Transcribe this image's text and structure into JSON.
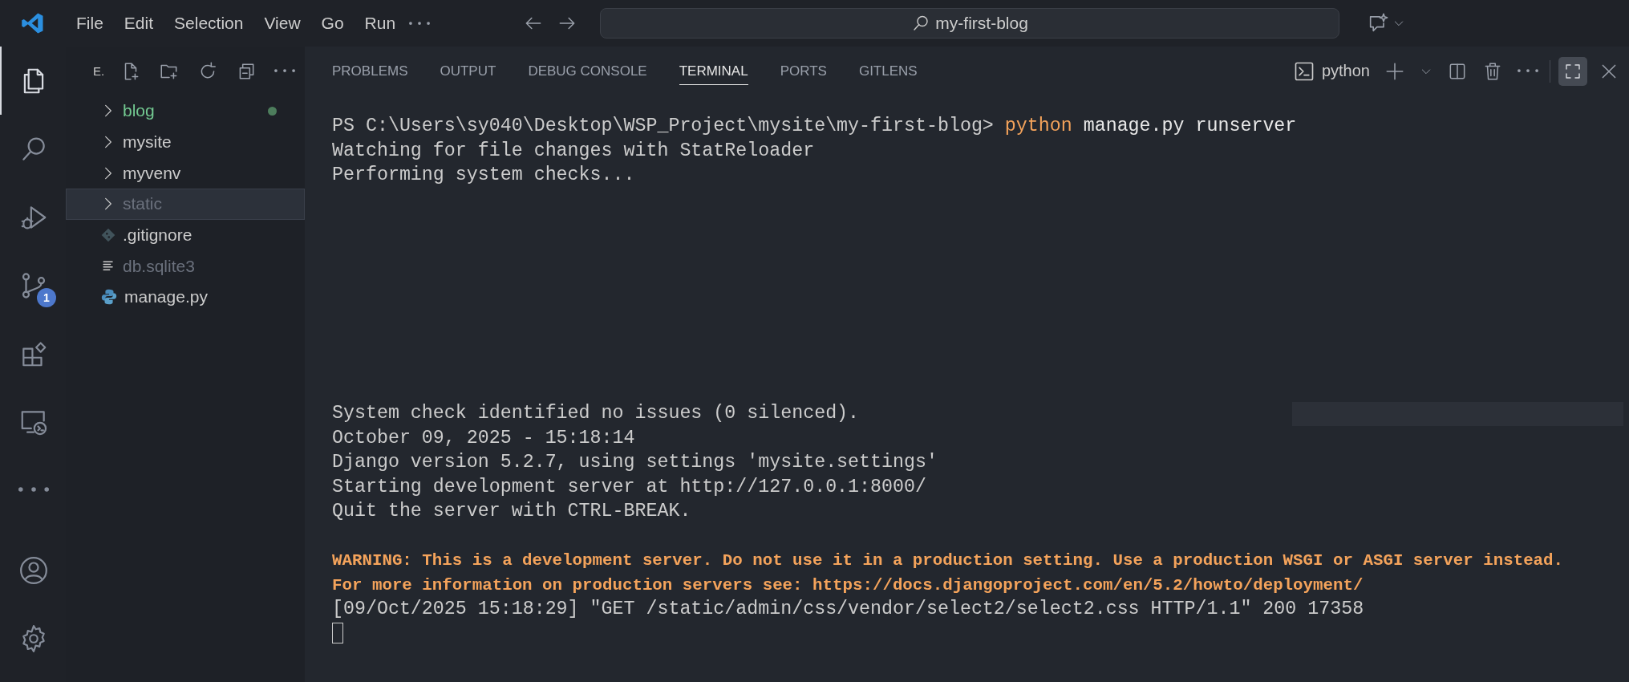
{
  "title_bar": {
    "menu": [
      "File",
      "Edit",
      "Selection",
      "View",
      "Go",
      "Run"
    ],
    "search": {
      "value": "my-first-blog"
    }
  },
  "activity_bar": {
    "items": [
      {
        "kind": "files",
        "selected": true
      },
      {
        "kind": "search",
        "selected": false
      },
      {
        "kind": "debug",
        "selected": false
      },
      {
        "kind": "scm",
        "selected": false,
        "badge": "1"
      },
      {
        "kind": "extensions",
        "selected": false
      },
      {
        "kind": "remote",
        "selected": false
      },
      {
        "kind": "more",
        "selected": false
      }
    ],
    "bottom": [
      {
        "kind": "account"
      },
      {
        "kind": "settings"
      }
    ]
  },
  "sidebar": {
    "title": "E.",
    "items": [
      {
        "label": "blog",
        "kind": "folder",
        "selected": false,
        "modified": true,
        "ignored": false
      },
      {
        "label": "mysite",
        "kind": "folder",
        "selected": false,
        "modified": false,
        "ignored": false
      },
      {
        "label": "myvenv",
        "kind": "folder",
        "selected": false,
        "modified": false,
        "ignored": false
      },
      {
        "label": "static",
        "kind": "folder",
        "selected": true,
        "modified": false,
        "ignored": true
      },
      {
        "label": ".gitignore",
        "kind": "git",
        "selected": false,
        "modified": false,
        "ignored": false
      },
      {
        "label": "db.sqlite3",
        "kind": "text",
        "selected": false,
        "modified": false,
        "ignored": true
      },
      {
        "label": "manage.py",
        "kind": "python",
        "selected": false,
        "modified": false,
        "ignored": false
      }
    ]
  },
  "panel": {
    "tabs": [
      {
        "label": "PROBLEMS",
        "selected": false
      },
      {
        "label": "OUTPUT",
        "selected": false
      },
      {
        "label": "DEBUG CONSOLE",
        "selected": false
      },
      {
        "label": "TERMINAL",
        "selected": true
      },
      {
        "label": "PORTS",
        "selected": false
      },
      {
        "label": "GITLENS",
        "selected": false
      }
    ],
    "terminal_profile": "python",
    "terminal": {
      "segments": [
        {
          "lines": [
            [
              {
                "kind": "plain",
                "text": "PS C:\\Users\\sy040\\Desktop\\WSP_Project\\mysite\\my-first-blog> "
              },
              {
                "kind": "command",
                "text": "python"
              },
              {
                "kind": "arg",
                "text": " manage.py runserver"
              }
            ],
            [
              {
                "kind": "plain",
                "text": "Watching for file changes with StatReloader"
              }
            ],
            [
              {
                "kind": "plain",
                "text": "Performing system checks..."
              }
            ]
          ]
        },
        {
          "lines": [
            [
              {
                "kind": "plain",
                "text": "System check identified no issues (0 silenced)."
              }
            ],
            [
              {
                "kind": "plain",
                "text": "October 09, 2025 - 15:18:14"
              }
            ],
            [
              {
                "kind": "plain",
                "text": "Django version 5.2.7, using settings 'mysite.settings'"
              }
            ],
            [
              {
                "kind": "plain",
                "text": "Starting development server at http://127.0.0.1:8000/"
              }
            ],
            [
              {
                "kind": "plain",
                "text": "Quit the server with CTRL-BREAK."
              }
            ]
          ]
        },
        {
          "lines": [
            [
              {
                "kind": "warning",
                "text": "WARNING: This is a development server. Do not use it in a production setting. Use a production WSGI or ASGI server instead."
              }
            ],
            [
              {
                "kind": "warning",
                "text": "For more information on production servers see: https://docs.djangoproject.com/en/5.2/howto/deployment/"
              }
            ],
            [
              {
                "kind": "plain",
                "text": "[09/Oct/2025 15:18:29] \"GET /static/admin/css/vendor/select2/select2.css HTTP/1.1\" 200 17358"
              }
            ]
          ]
        }
      ],
      "cursor": true
    }
  }
}
